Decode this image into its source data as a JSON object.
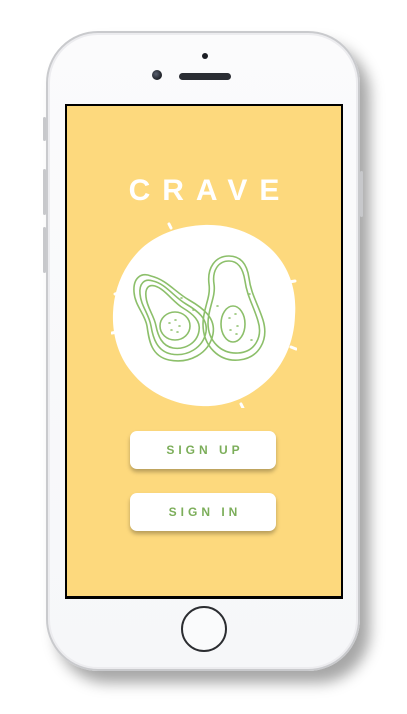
{
  "app": {
    "title": "CRAVE",
    "sign_up_label": "SIGN UP",
    "sign_in_label": "SIGN IN"
  },
  "icons": {
    "logo": "avocado-icon"
  },
  "colors": {
    "background": "#fdd97d",
    "accent": "#7cae5a",
    "button": "#ffffff"
  }
}
